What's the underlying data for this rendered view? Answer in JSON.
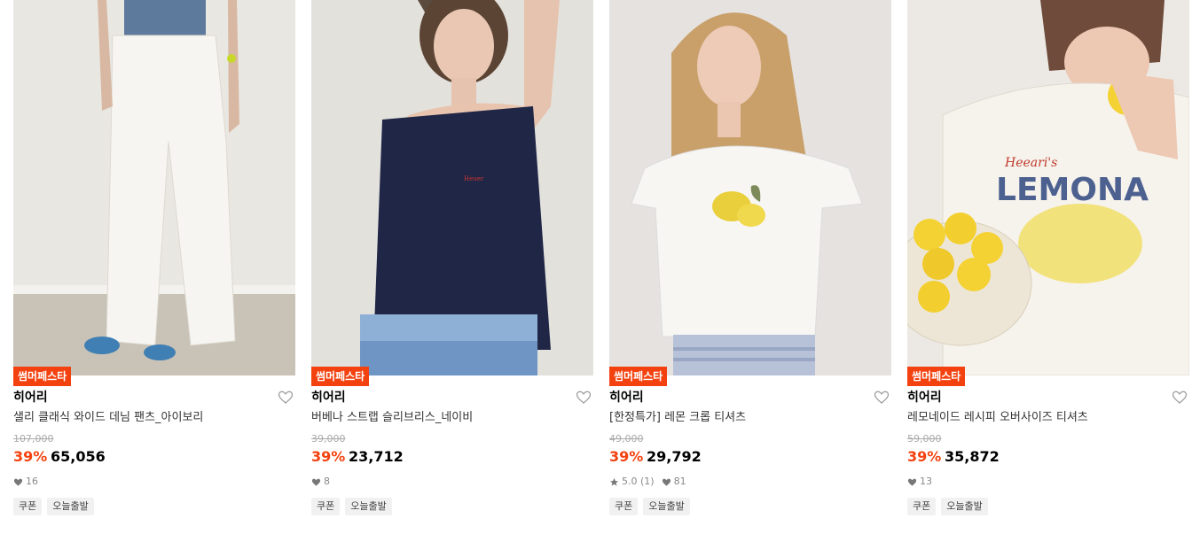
{
  "products": [
    {
      "promo": "썸머페스타",
      "brand": "히어리",
      "name": "샐리 클래식 와이드 데님 팬츠_아이보리",
      "original_price": "107,000",
      "discount": "39%",
      "price": "65,056",
      "rating": "",
      "likes": "16",
      "tags": [
        "쿠폰",
        "오늘출발"
      ],
      "image": "model-white-wide-denim-pants"
    },
    {
      "promo": "썸머페스타",
      "brand": "히어리",
      "name": "버베나 스트랩 슬리브리스_네이비",
      "original_price": "39,000",
      "discount": "39%",
      "price": "23,712",
      "rating": "",
      "likes": "8",
      "tags": [
        "쿠폰",
        "오늘출발"
      ],
      "image": "model-navy-strap-sleeveless"
    },
    {
      "promo": "썸머페스타",
      "brand": "히어리",
      "name": "[한정특가] 레몬 크롭 티셔츠",
      "original_price": "49,000",
      "discount": "39%",
      "price": "29,792",
      "rating": "5.0 (1)",
      "likes": "81",
      "tags": [
        "쿠폰",
        "오늘출발"
      ],
      "image": "model-lemon-crop-tshirt"
    },
    {
      "promo": "썸머페스타",
      "brand": "히어리",
      "name": "레모네이드 레시피 오버사이즈 티셔츠",
      "original_price": "59,000",
      "discount": "39%",
      "price": "35,872",
      "rating": "",
      "likes": "13",
      "tags": [
        "쿠폰",
        "오늘출발"
      ],
      "image": "model-lemonade-oversize-tshirt"
    }
  ],
  "colors": {
    "accent": "#f3420f",
    "tag_bg": "#f1f1f1"
  },
  "icons": {
    "like": "heart-icon",
    "rating": "star-icon",
    "wishlist": "heart-outline-icon"
  }
}
